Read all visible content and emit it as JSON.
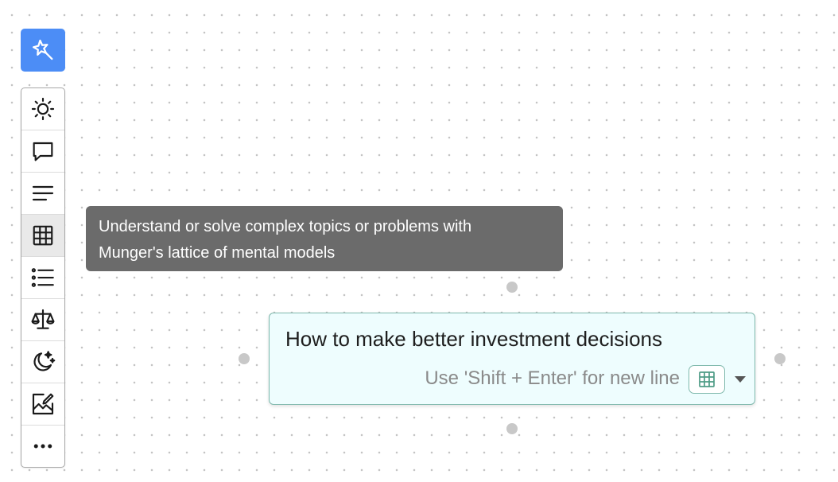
{
  "colors": {
    "accent": "#4c8df6",
    "node_background": "#eefdfe",
    "node_border": "#7fb9ad",
    "tooltip_background": "#6b6b6b"
  },
  "ai_button": {
    "icon": "magic-wand-icon"
  },
  "toolbar": {
    "active_item": "grid-icon",
    "items": [
      {
        "icon": "sun-icon"
      },
      {
        "icon": "chat-bubble-icon"
      },
      {
        "icon": "text-lines-icon"
      },
      {
        "icon": "grid-icon"
      },
      {
        "icon": "bullet-list-icon"
      },
      {
        "icon": "balance-scale-icon"
      },
      {
        "icon": "moon-stars-icon"
      },
      {
        "icon": "image-edit-icon"
      },
      {
        "icon": "more-icon"
      }
    ]
  },
  "tooltip": {
    "line1": "Understand or solve complex topics or problems with",
    "line2": "Munger's lattice of mental models"
  },
  "node": {
    "value": "How to make better investment decisions",
    "hint": "Use 'Shift + Enter' for new line",
    "mode_icon": "grid-icon",
    "dropdown_icon": "caret-down-icon"
  }
}
